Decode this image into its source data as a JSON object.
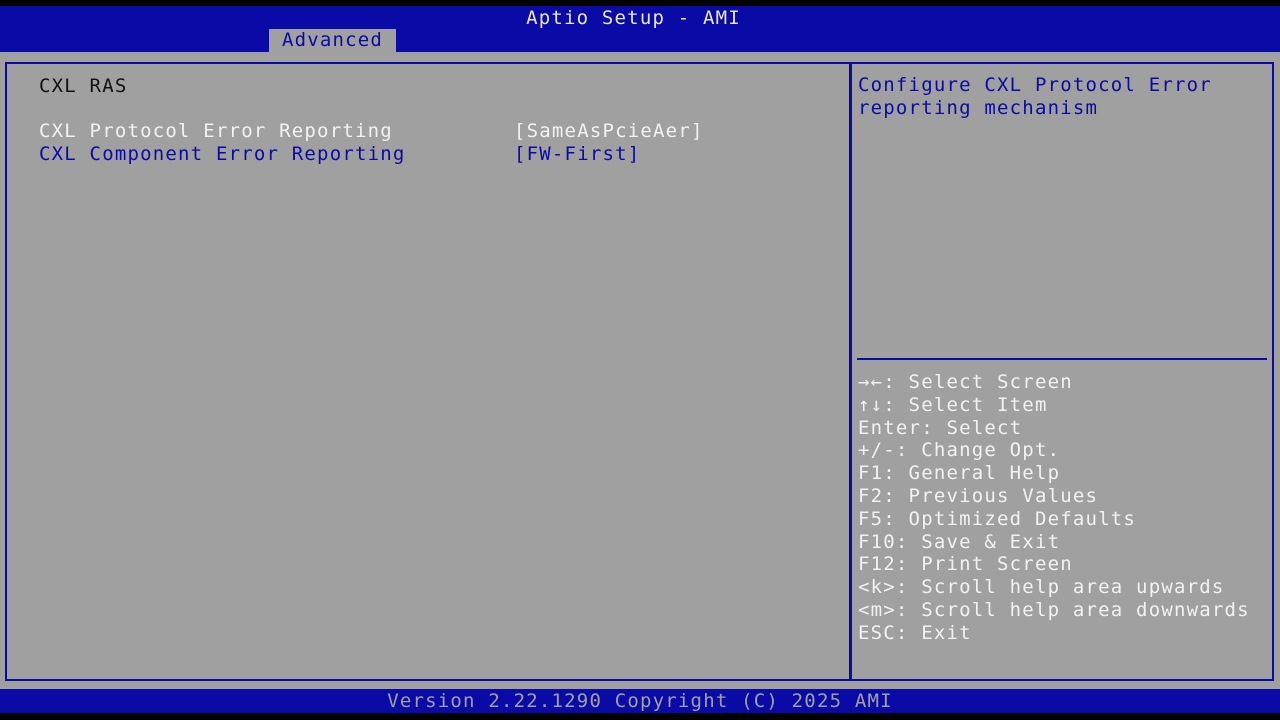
{
  "header": {
    "title": "Aptio Setup - AMI",
    "active_tab": "Advanced"
  },
  "main": {
    "section_title": "CXL RAS",
    "settings": [
      {
        "label": "CXL Protocol Error Reporting",
        "value": "[SameAsPcieAer]",
        "selected": true
      },
      {
        "label": "CXL Component Error Reporting",
        "value": "[FW-First]",
        "selected": false
      }
    ]
  },
  "help": {
    "lines": [
      "Configure CXL Protocol Error",
      "reporting mechanism"
    ]
  },
  "keys": [
    "→←: Select Screen",
    "↑↓: Select Item",
    "Enter: Select",
    "+/-: Change Opt.",
    "F1: General Help",
    "F2: Previous Values",
    "F5: Optimized Defaults",
    "F10: Save & Exit",
    "F12: Print Screen",
    "<k>: Scroll help area upwards",
    "<m>: Scroll help area downwards",
    "ESC: Exit"
  ],
  "footer": {
    "version": "Version 2.22.1290 Copyright (C) 2025 AMI"
  },
  "colors": {
    "bios_blue": "#0a0aa6",
    "panel_gray": "#a0a0a0",
    "selected_text": "#f2f2f2",
    "body_text": "#111111"
  }
}
